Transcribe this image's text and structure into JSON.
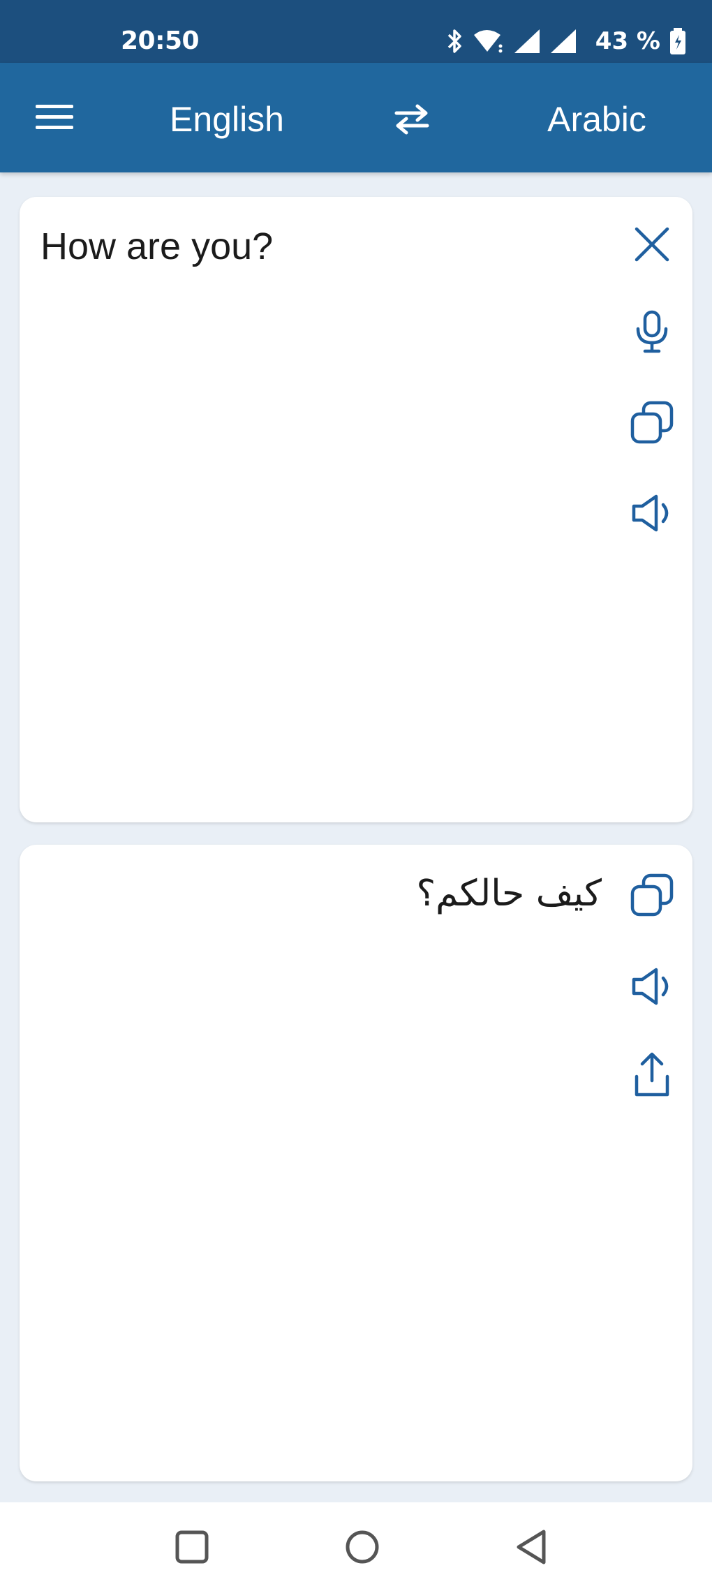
{
  "status_bar": {
    "time": "20:50",
    "battery": "43 %",
    "icons": [
      "bluetooth-icon",
      "wifi-icon",
      "signal-icon",
      "signal-icon",
      "battery-icon"
    ]
  },
  "app_bar": {
    "source_language": "English",
    "target_language": "Arabic",
    "icons": {
      "menu": "menu-icon",
      "swap": "swap-icon"
    }
  },
  "source_card": {
    "text": "How are you?",
    "icons": [
      "close-icon",
      "microphone-icon",
      "copy-icon",
      "speaker-icon"
    ]
  },
  "target_card": {
    "text": "كيف حالكم؟",
    "icons": [
      "copy-icon",
      "speaker-icon",
      "share-icon"
    ]
  },
  "nav_bar": {
    "icons": [
      "recents-icon",
      "home-icon",
      "back-icon"
    ]
  },
  "colors": {
    "status_bar": "#1c4f7e",
    "app_bar": "#20679e",
    "accent": "#1f5f9f",
    "background": "#e9eff6"
  }
}
